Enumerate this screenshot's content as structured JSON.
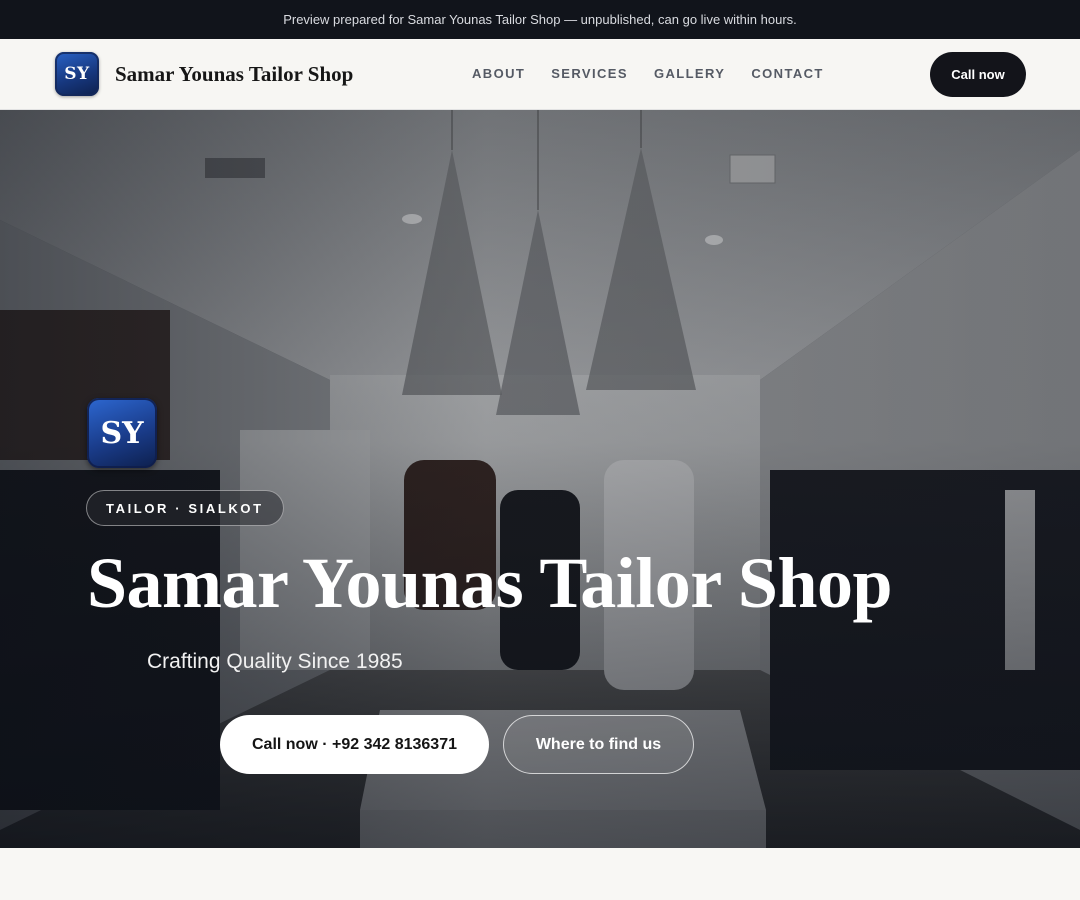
{
  "topbar": {
    "notice": "Preview prepared for Samar Younas Tailor Shop — unpublished, can go live within hours."
  },
  "header": {
    "logo_initials": "SY",
    "brand_name": "Samar Younas Tailor Shop",
    "nav": [
      "ABOUT",
      "SERVICES",
      "GALLERY",
      "CONTACT"
    ],
    "cta_label": "Call now"
  },
  "hero": {
    "logo_initials": "SY",
    "category_pill": "TAILOR · SIALKOT",
    "title": "Samar Younas Tailor Shop",
    "subtitle": "Crafting Quality Since 1985",
    "primary_button": "Call now · +92 342 8136371",
    "secondary_button": "Where to find us",
    "background_image": "boutique-interior-photo"
  },
  "colors": {
    "dark": "#11141b",
    "logo_blue": "#1a3c8a",
    "page_bg": "#f7f6f3"
  }
}
